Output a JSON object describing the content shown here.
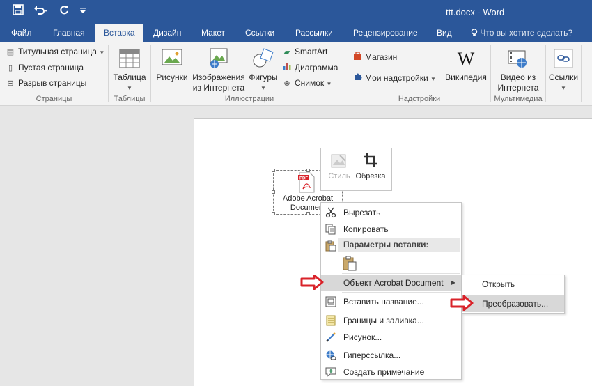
{
  "window": {
    "title": "ttt.docx - Word",
    "qat": {
      "save_icon": "save-icon",
      "undo_icon": "undo-icon",
      "redo_icon": "redo-icon",
      "customize_icon": "customize-qat-icon"
    }
  },
  "tabs": [
    {
      "label": "Файл"
    },
    {
      "label": "Главная"
    },
    {
      "label": "Вставка"
    },
    {
      "label": "Дизайн"
    },
    {
      "label": "Макет"
    },
    {
      "label": "Ссылки"
    },
    {
      "label": "Рассылки"
    },
    {
      "label": "Рецензирование"
    },
    {
      "label": "Вид"
    }
  ],
  "active_tab": "Вставка",
  "tell_me": "Что вы хотите сделать?",
  "ribbon": {
    "pages": {
      "label": "Страницы",
      "items": [
        "Титульная страница",
        "Пустая страница",
        "Разрыв страницы"
      ]
    },
    "tables": {
      "label": "Таблицы",
      "table": "Таблица"
    },
    "illustrations": {
      "label": "Иллюстрации",
      "pictures": "Рисунки",
      "online_line1": "Изображения",
      "online_line2": "из Интернета",
      "shapes": "Фигуры",
      "smartart": "SmartArt",
      "chart": "Диаграмма",
      "screenshot": "Снимок"
    },
    "addins": {
      "label": "Надстройки",
      "store": "Магазин",
      "my_addins": "Мои надстройки",
      "wikipedia": "Википедия"
    },
    "media": {
      "label": "Мультимедиа",
      "video_line1": "Видео из",
      "video_line2": "Интернета"
    },
    "links": {
      "label": "Ссылки"
    }
  },
  "document": {
    "object_label_line1": "Adobe Acrobat",
    "object_label_line2": "Document",
    "pdf_badge": "PDF"
  },
  "mini_toolbar": {
    "style": "Стиль",
    "crop": "Обрезка"
  },
  "context_menu": {
    "cut": "Вырезать",
    "copy": "Копировать",
    "paste_options": "Параметры вставки:",
    "acrobat_object": "Объект Acrobat Document",
    "insert_caption": "Вставить название...",
    "borders": "Границы и заливка...",
    "picture": "Рисунок...",
    "hyperlink": "Гиперссылка...",
    "comment": "Создать примечание"
  },
  "submenu": {
    "open": "Открыть",
    "convert": "Преобразовать..."
  },
  "colors": {
    "word_blue": "#2b579a",
    "annotation_red": "#d9232a",
    "highlight": "#d8d8d8"
  }
}
